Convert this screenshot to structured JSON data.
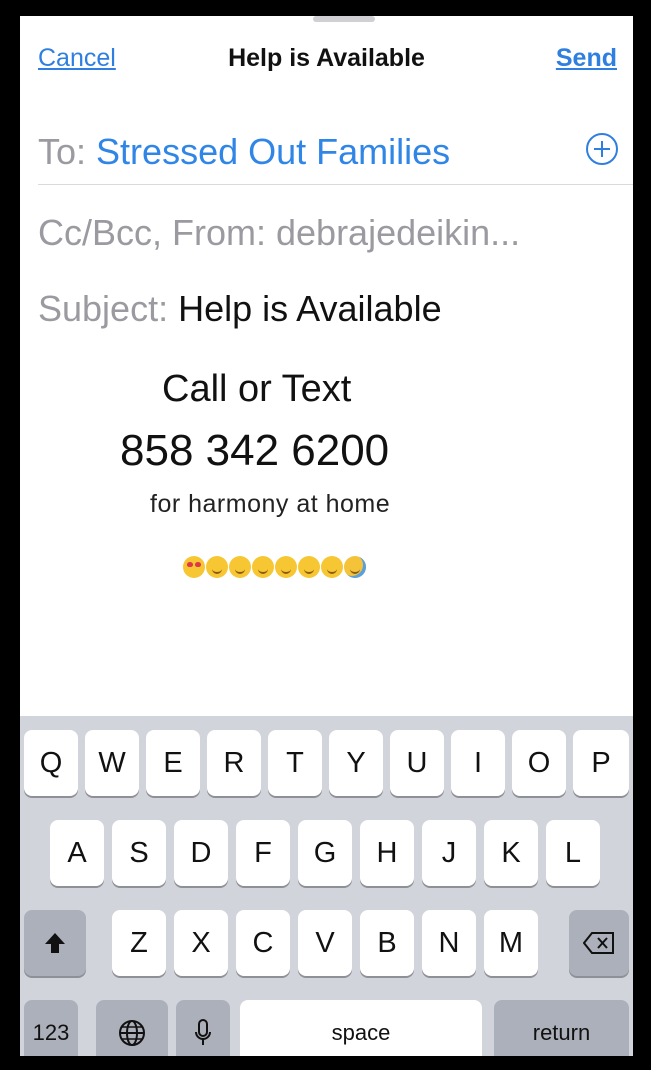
{
  "navbar": {
    "cancel_label": "Cancel",
    "title": "Help is Available",
    "send_label": "Send"
  },
  "to": {
    "label": "To:",
    "value": "Stressed Out Families"
  },
  "cc": {
    "text": "Cc/Bcc, From: debrajedeikin..."
  },
  "subject": {
    "label": "Subject:",
    "value": "Help is Available"
  },
  "body": {
    "line1": "Call or Text",
    "line2": "858 342 6200",
    "line3": "for harmony at home",
    "emoji": [
      "heart-eyes",
      "smile",
      "smile",
      "smile",
      "smile",
      "smile",
      "smile",
      "sweat-smile"
    ]
  },
  "keyboard": {
    "row1": [
      "Q",
      "W",
      "E",
      "R",
      "T",
      "Y",
      "U",
      "I",
      "O",
      "P"
    ],
    "row2": [
      "A",
      "S",
      "D",
      "F",
      "G",
      "H",
      "J",
      "K",
      "L"
    ],
    "row3": [
      "Z",
      "X",
      "C",
      "V",
      "B",
      "N",
      "M"
    ],
    "numbers_label": "123",
    "space_label": "space",
    "return_label": "return"
  },
  "colors": {
    "accent": "#2f7fe0",
    "keyboard_bg": "#d2d4db",
    "key_dark": "#acb0ba"
  }
}
